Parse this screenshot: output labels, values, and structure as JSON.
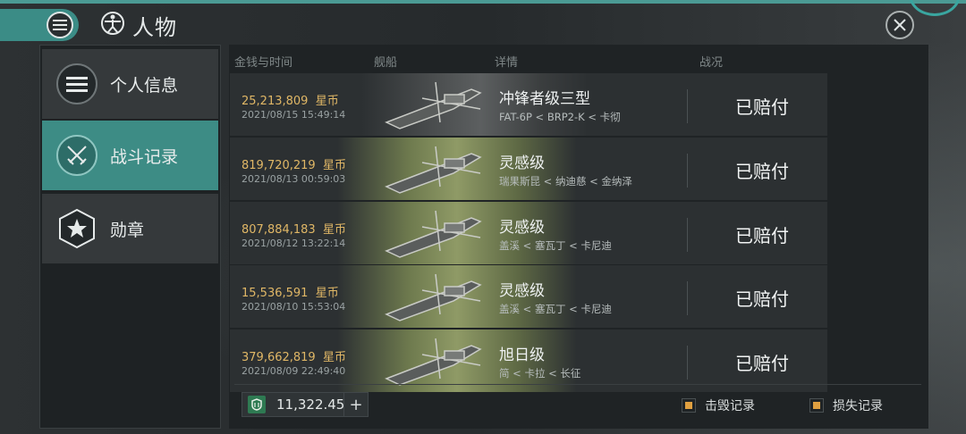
{
  "header": {
    "title": "人物",
    "menu_icon": "menu-icon",
    "title_icon": "vitruvian-icon",
    "close_icon": "close-icon"
  },
  "sidebar": {
    "items": [
      {
        "label": "个人信息",
        "icon": "list-icon",
        "active": false
      },
      {
        "label": "战斗记录",
        "icon": "crossed-swords-icon",
        "active": true
      },
      {
        "label": "勋章",
        "icon": "star-hex-icon",
        "active": false
      }
    ]
  },
  "table": {
    "columns": [
      "金钱与时间",
      "舰船",
      "详情",
      "战况"
    ],
    "rows": [
      {
        "money": "25,213,809",
        "currency": "星币",
        "date": "2021/08/15  15:49:14",
        "ship": "冲锋者级三型",
        "route": "FAT-6P < BRP2-K < 卡彻",
        "status": "已赔付",
        "bg": "dark"
      },
      {
        "money": "819,720,219",
        "currency": "星币",
        "date": "2021/08/13  00:59:03",
        "ship": "灵感级",
        "route": "瑞果斯昆 < 纳迪慈 < 金纳泽",
        "status": "已赔付",
        "bg": "green"
      },
      {
        "money": "807,884,183",
        "currency": "星币",
        "date": "2021/08/12  13:22:14",
        "ship": "灵感级",
        "route": "盖溪 < 塞瓦丁 < 卡尼迪",
        "status": "已赔付",
        "bg": "green"
      },
      {
        "money": "15,536,591",
        "currency": "星币",
        "date": "2021/08/10  15:53:04",
        "ship": "灵感级",
        "route": "盖溪 < 塞瓦丁 < 卡尼迪",
        "status": "已赔付",
        "bg": "green"
      },
      {
        "money": "379,662,819",
        "currency": "星币",
        "date": "2021/08/09  22:49:40",
        "ship": "旭日级",
        "route": "简 < 卡拉 < 长征",
        "status": "已赔付",
        "bg": "green"
      }
    ]
  },
  "footer": {
    "balance": "11,322.45",
    "plus": "+",
    "kill_record": "击毁记录",
    "loss_record": "损失记录"
  },
  "colors": {
    "accent": "#3d8c85",
    "money": "#e0b766",
    "legend_marker": "#e0a040"
  }
}
